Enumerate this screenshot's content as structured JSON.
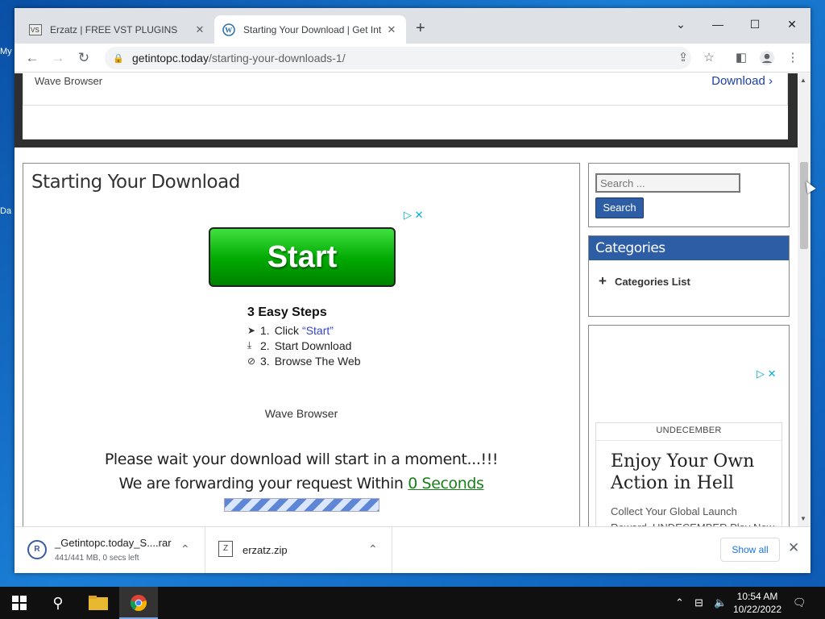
{
  "desktop": {
    "frag_top": "My",
    "frag_mid": "Da"
  },
  "browser": {
    "tabs": [
      {
        "title": "Erzatz | FREE VST PLUGINS",
        "favicon": "vst-icon"
      },
      {
        "title": "Starting Your Download | Get Int",
        "favicon": "wordpress-icon"
      }
    ],
    "new_tab": "+",
    "url_host": "getintopc.today",
    "url_path": "/starting-your-downloads-1/"
  },
  "page": {
    "top_ad": {
      "name": "Wave Browser",
      "download": "Download ›"
    },
    "title": "Starting Your Download",
    "start_button": "Start",
    "steps": {
      "title": "3 Easy Steps",
      "items": [
        {
          "num": "1.",
          "text": "Click",
          "link": "“Start”"
        },
        {
          "num": "2.",
          "text": "Start Download"
        },
        {
          "num": "3.",
          "text": "Browse The Web"
        }
      ]
    },
    "wave_browser": "Wave Browser",
    "wait_line1": "Please wait your download will start in a moment...!!!",
    "wait_line2": "We are forwarding your request Within",
    "seconds": "0 Seconds",
    "progress_animating": true
  },
  "sidebar": {
    "search_placeholder": "Search ...",
    "search_button": "Search",
    "categories_title": "Categories",
    "categories_item": "Categories List",
    "ad": {
      "brand": "UNDECEMBER",
      "headline": "Enjoy Your Own Action in Hell",
      "body": "Collect Your Global Launch Reward. UNDECEMBER Play Now"
    }
  },
  "downloads": {
    "items": [
      {
        "name": "_Getintopc.today_S....rar",
        "status": "441/441 MB, 0 secs left"
      },
      {
        "name": "erzatz.zip"
      }
    ],
    "show_all": "Show all"
  },
  "taskbar": {
    "time": "10:54 AM",
    "date": "10/22/2022"
  },
  "colors": {
    "accent": "#2d5ea5",
    "start_green": "#00a800",
    "link_green": "#1a7f1a",
    "chrome_blue": "#1a73e8"
  }
}
